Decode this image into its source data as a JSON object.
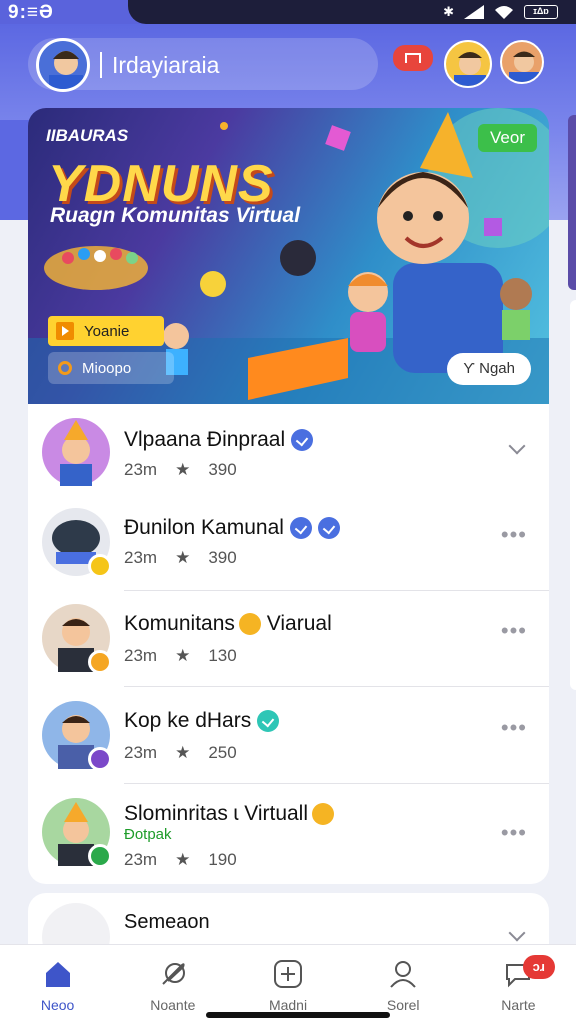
{
  "status": {
    "time": "9:≡Ə",
    "battery": "ɪΔɒ"
  },
  "header": {
    "search_text": "Irdayiaraia"
  },
  "banner": {
    "brand": "IIBAURAS",
    "title": "YDNUNS",
    "subtitle": "Ruagn Komunitas Virtual",
    "new_badge": "Veor",
    "button_primary": "Yoanie",
    "button_secondary": "Mioopo",
    "button_right": "Ƴ Ngah"
  },
  "list": [
    {
      "title": "Vlpaana Ɖinpraal",
      "time": "23m",
      "count": "390",
      "action": "chevron",
      "badge_color": "#4a6fe0"
    },
    {
      "title": "Ɖunilon Kamunal",
      "time": "23m",
      "count": "390",
      "action": "more",
      "badge_color": "#4a6fe0"
    },
    {
      "title": "Komunitans",
      "title_suffix": "Viarual",
      "time": "23m",
      "count": "130",
      "action": "more",
      "badge_color": "#f5b423"
    },
    {
      "title": "Kop ke dHars",
      "time": "23m",
      "count": "250",
      "action": "more",
      "badge_color": "#2ec6b6"
    },
    {
      "title": "Slominritas ɩ Virtuall",
      "subtitle": "Ɖotpak",
      "time": "23m",
      "count": "190",
      "action": "more",
      "badge_color": "#2aa94a"
    }
  ],
  "card2": {
    "title": "Semeaon"
  },
  "nav": [
    {
      "label": "Neoo",
      "icon": "home-icon",
      "active": true
    },
    {
      "label": "Noante",
      "icon": "feather-icon",
      "active": false
    },
    {
      "label": "Madni",
      "icon": "add-icon",
      "active": false
    },
    {
      "label": "Sorel",
      "icon": "person-icon",
      "active": false
    },
    {
      "label": "Narte",
      "icon": "chat-icon",
      "active": false,
      "badge": "ɔɹ"
    }
  ],
  "colors": {
    "accent": "#5c68e2",
    "nav_active": "#3e55c9",
    "alert": "#e53935"
  }
}
